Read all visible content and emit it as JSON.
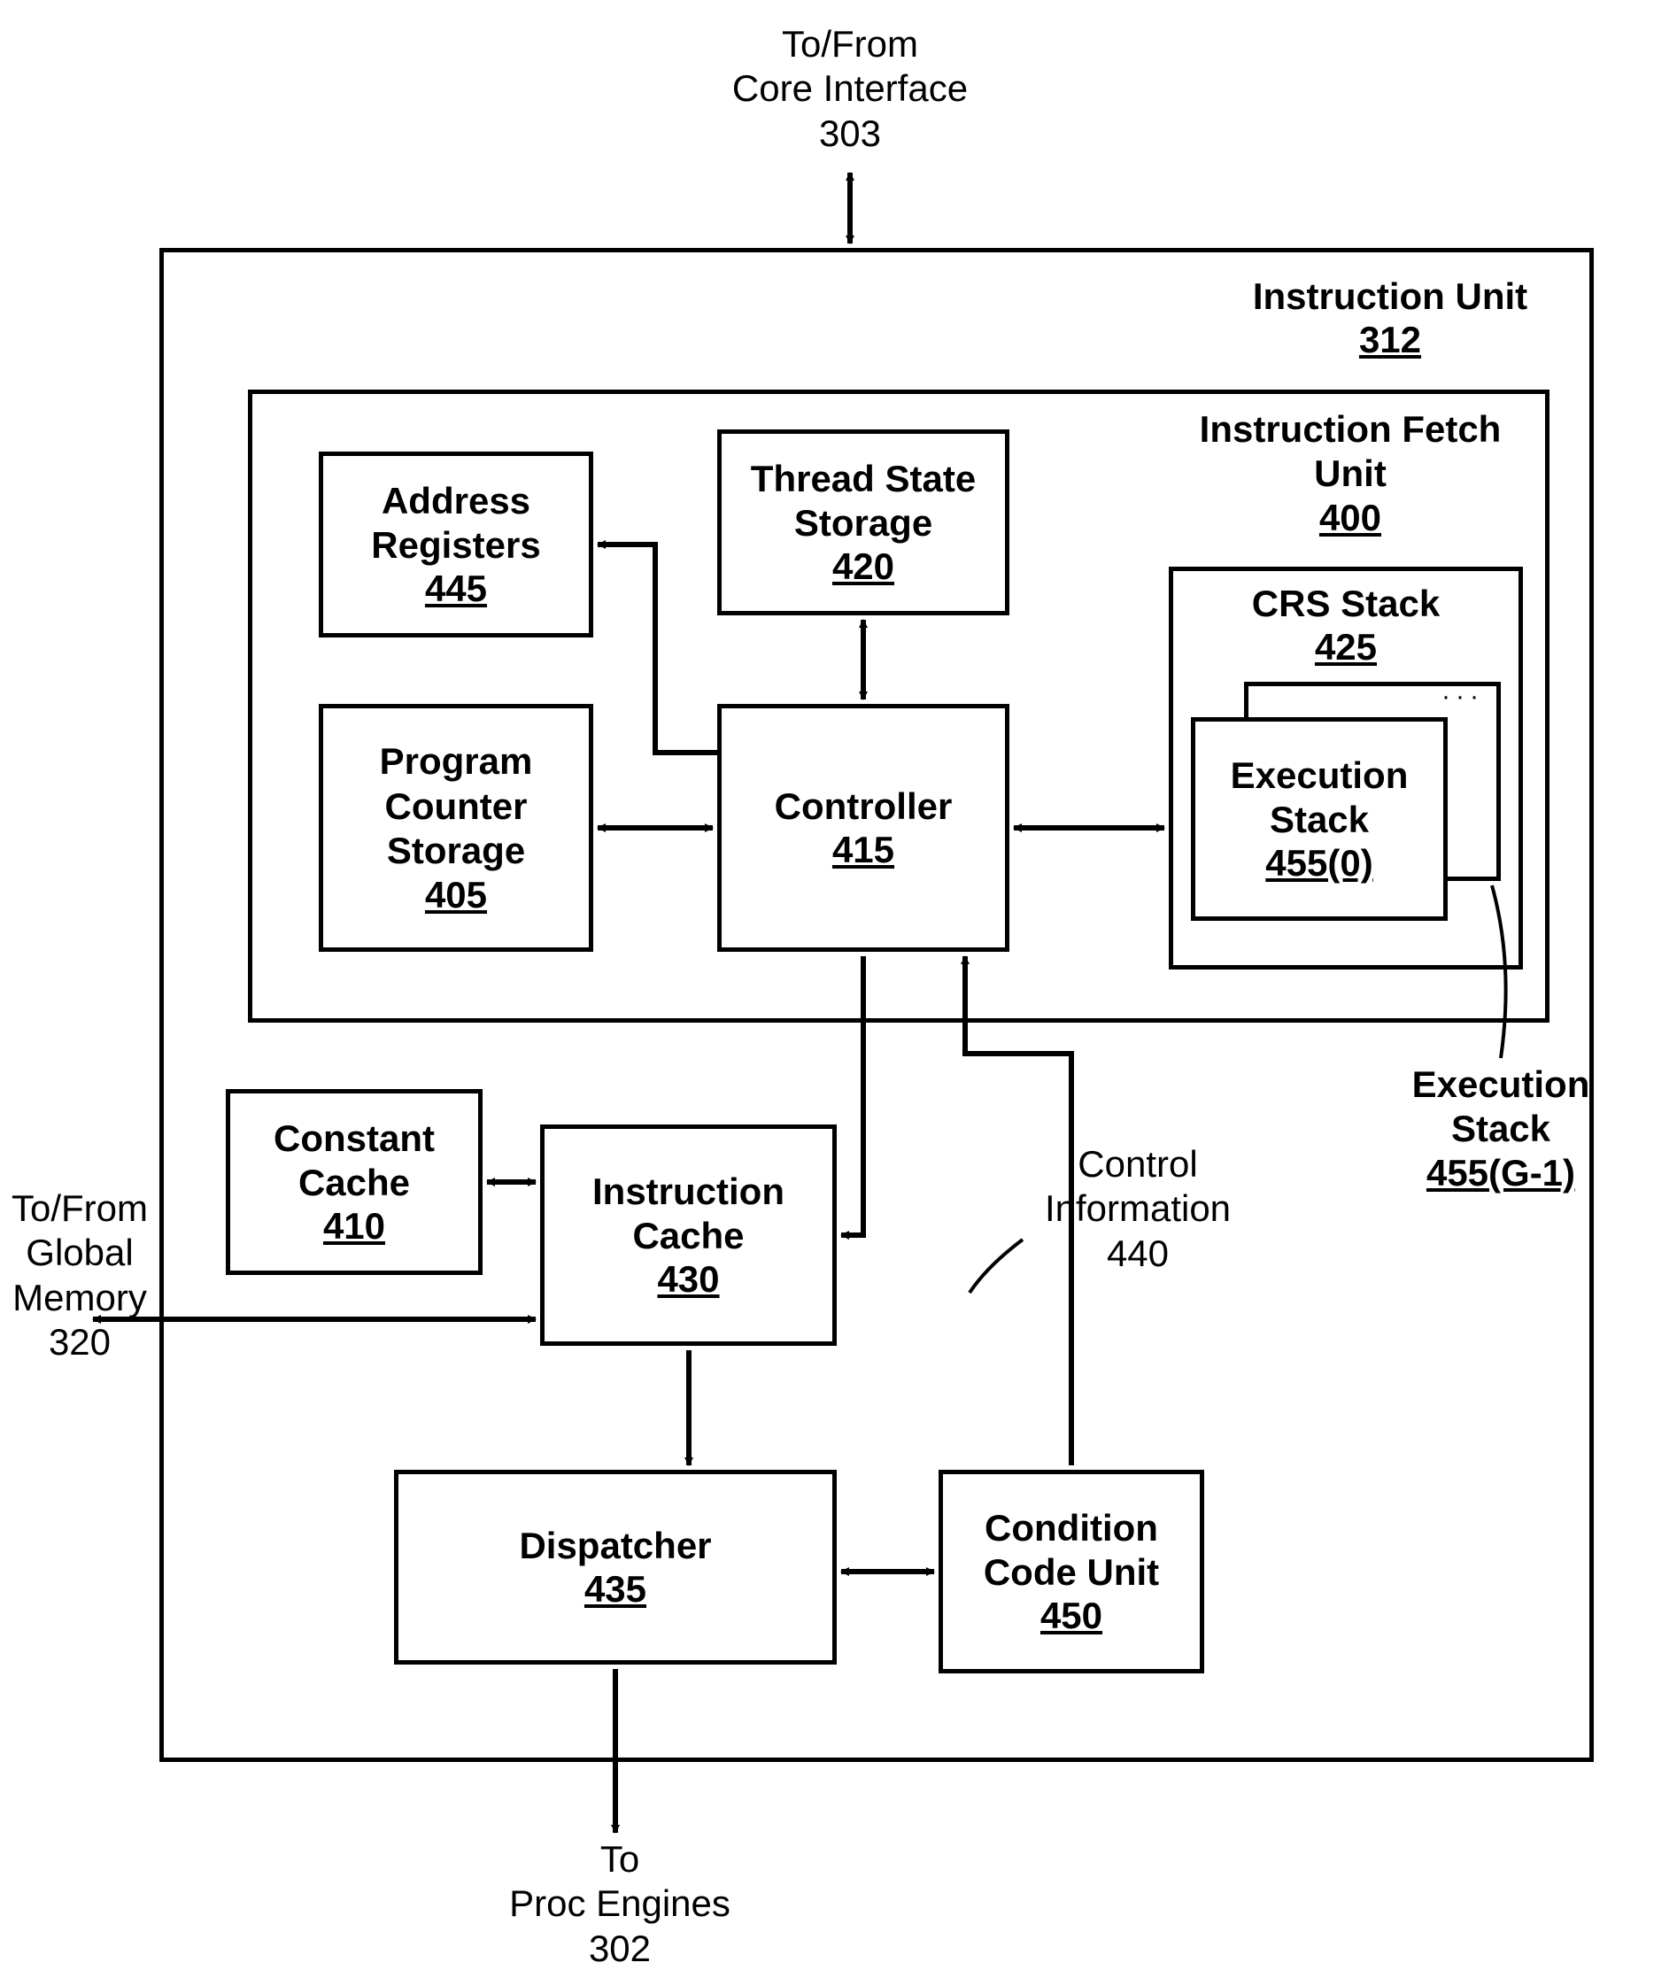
{
  "top_label": {
    "line1": "To/From",
    "line2": "Core Interface",
    "num": "303"
  },
  "instruction_unit": {
    "title": "Instruction Unit",
    "num": "312"
  },
  "fetch_unit": {
    "title": "Instruction Fetch",
    "title2": "Unit",
    "num": "400"
  },
  "address_registers": {
    "title": "Address",
    "title2": "Registers",
    "num": "445"
  },
  "thread_state": {
    "title": "Thread State",
    "title2": "Storage",
    "num": "420"
  },
  "crs_stack": {
    "title": "CRS Stack",
    "num": "425"
  },
  "exec_stack_0": {
    "title": "Execution",
    "title2": "Stack",
    "num": "455(0)"
  },
  "exec_stack_g": {
    "title": "Execution",
    "title2": "Stack",
    "num": "455(G-1)"
  },
  "program_counter": {
    "title": "Program",
    "title2": "Counter",
    "title3": "Storage",
    "num": "405"
  },
  "controller": {
    "title": "Controller",
    "num": "415"
  },
  "constant_cache": {
    "title": "Constant",
    "title2": "Cache",
    "num": "410"
  },
  "instruction_cache": {
    "title": "Instruction",
    "title2": "Cache",
    "num": "430"
  },
  "dispatcher": {
    "title": "Dispatcher",
    "num": "435"
  },
  "condition_code": {
    "title": "Condition",
    "title2": "Code Unit",
    "num": "450"
  },
  "control_info": {
    "title": "Control",
    "title2": "Information",
    "num": "440"
  },
  "global_mem": {
    "line1": "To/From",
    "line2": "Global",
    "line3": "Memory",
    "num": "320"
  },
  "bottom_label": {
    "line1": "To",
    "line2": "Proc Engines",
    "num": "302"
  }
}
